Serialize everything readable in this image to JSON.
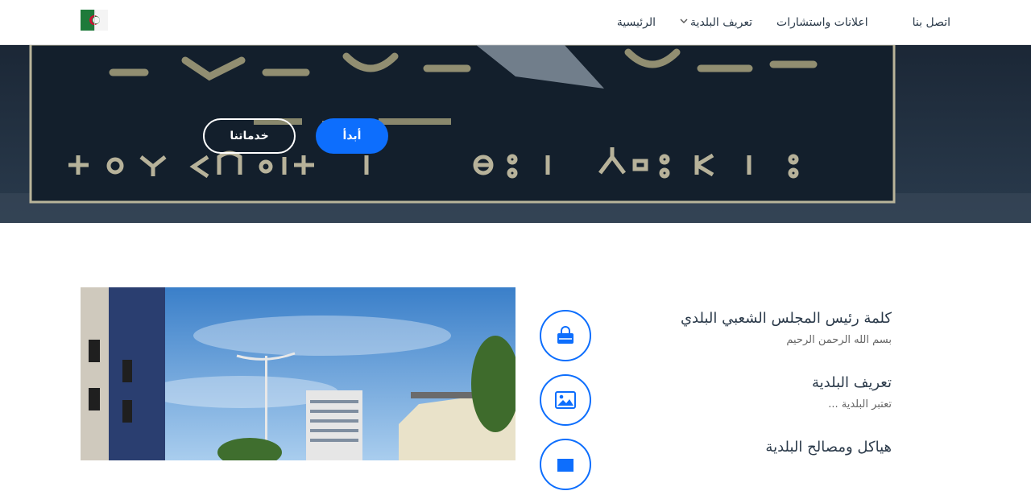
{
  "nav": {
    "items": [
      {
        "label": "الرئيسية"
      },
      {
        "label": "تعريف البلدية",
        "has_dropdown": true
      },
      {
        "label": "اعلانات واستشارات"
      },
      {
        "label": "اتصل بنا"
      }
    ]
  },
  "hero": {
    "start_label": "أبدأ",
    "services_label": "خدماتنا"
  },
  "features": [
    {
      "title": "كلمة رئيس المجلس الشعبي البلدي",
      "desc": "بسم الله الرحمن الرحيم",
      "icon": "shopping-bag-icon"
    },
    {
      "title": "تعريف البلدية",
      "desc": "تعتبر البلدية ...",
      "icon": "image-icon"
    },
    {
      "title": "هياكل ومصالح البلدية",
      "desc": "",
      "icon": "building-icon"
    }
  ],
  "colors": {
    "accent": "#0d6efd",
    "hero_dark": "#1a2836",
    "text": "#2b3a4a"
  }
}
